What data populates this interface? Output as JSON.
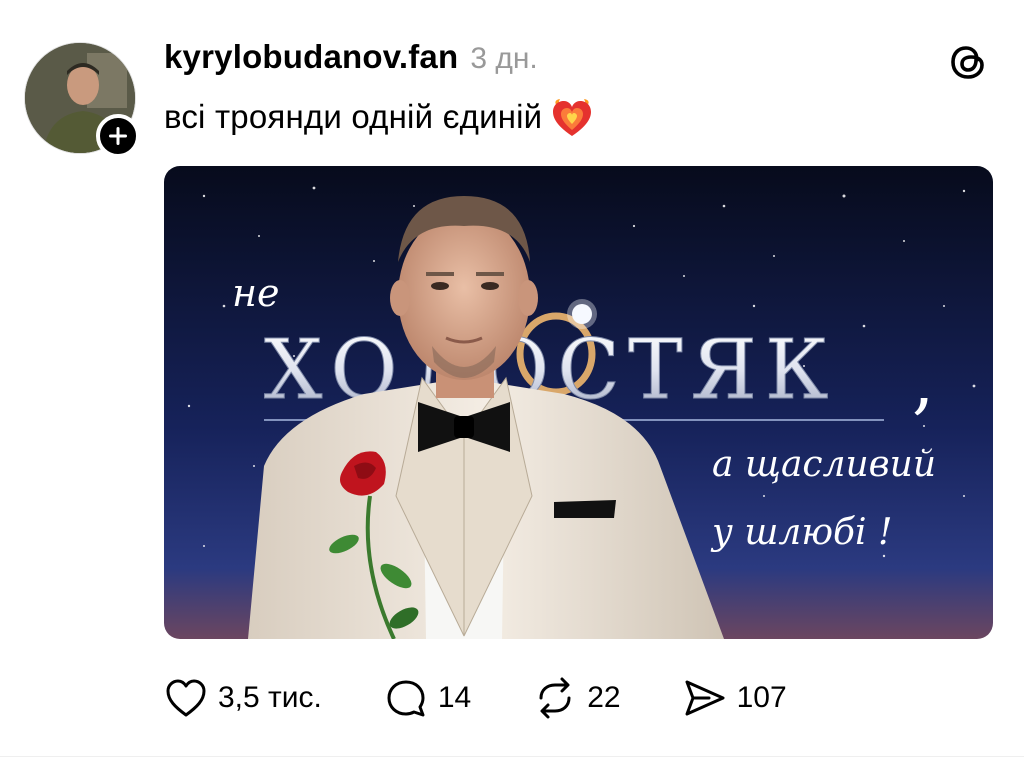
{
  "post": {
    "username": "kyrylobudanov.fan",
    "time": "3 дн.",
    "caption": "всі троянди одній єдиній",
    "caption_emoji": "heart-on-fire-emoji"
  },
  "image_overlay": {
    "line_top": "не",
    "line_title": "ХОЛОСТЯК",
    "line_comma": ",",
    "line_2": "а щасливий",
    "line_3": "у шлюбі !"
  },
  "actions": {
    "likes": "3,5 тис.",
    "replies": "14",
    "reposts": "22",
    "shares": "107"
  },
  "colors": {
    "sky_dark": "#0b1024",
    "sky_mid": "#1f2e62",
    "suit": "#efe7dc",
    "rose": "#c0141e",
    "muted_text": "#999999"
  }
}
